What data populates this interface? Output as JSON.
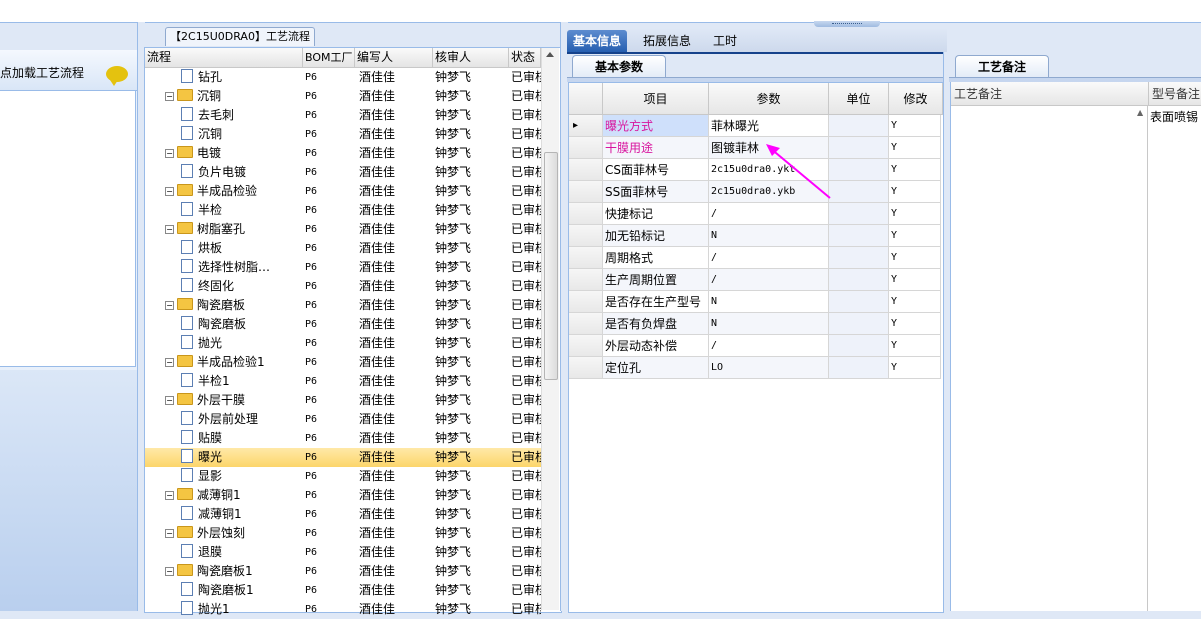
{
  "flow_panel": {
    "load_text": "点加载工艺流程",
    "title": "【2C15U0DRA0】工艺流程",
    "columns": [
      "流程",
      "BOM工厂",
      "编写人",
      "核审人",
      "状态"
    ],
    "rows": [
      {
        "name": "钻孔",
        "level": 2,
        "type": "file",
        "bom": "P6",
        "writer": "酒佳佳",
        "reviewer": "钟梦飞",
        "status": "已审核"
      },
      {
        "name": "沉铜",
        "level": 1,
        "type": "folder",
        "bom": "P6",
        "writer": "酒佳佳",
        "reviewer": "钟梦飞",
        "status": "已审核"
      },
      {
        "name": "去毛刺",
        "level": 2,
        "type": "file",
        "bom": "P6",
        "writer": "酒佳佳",
        "reviewer": "钟梦飞",
        "status": "已审核"
      },
      {
        "name": "沉铜",
        "level": 2,
        "type": "file",
        "bom": "P6",
        "writer": "酒佳佳",
        "reviewer": "钟梦飞",
        "status": "已审核"
      },
      {
        "name": "电镀",
        "level": 1,
        "type": "folder",
        "bom": "P6",
        "writer": "酒佳佳",
        "reviewer": "钟梦飞",
        "status": "已审核"
      },
      {
        "name": "负片电镀",
        "level": 2,
        "type": "file",
        "bom": "P6",
        "writer": "酒佳佳",
        "reviewer": "钟梦飞",
        "status": "已审核"
      },
      {
        "name": "半成品检验",
        "level": 1,
        "type": "folder",
        "bom": "P6",
        "writer": "酒佳佳",
        "reviewer": "钟梦飞",
        "status": "已审核"
      },
      {
        "name": "半检",
        "level": 2,
        "type": "file",
        "bom": "P6",
        "writer": "酒佳佳",
        "reviewer": "钟梦飞",
        "status": "已审核"
      },
      {
        "name": "树脂塞孔",
        "level": 1,
        "type": "folder",
        "bom": "P6",
        "writer": "酒佳佳",
        "reviewer": "钟梦飞",
        "status": "已审核"
      },
      {
        "name": "烘板",
        "level": 2,
        "type": "file",
        "bom": "P6",
        "writer": "酒佳佳",
        "reviewer": "钟梦飞",
        "status": "已审核"
      },
      {
        "name": "选择性树脂…",
        "level": 2,
        "type": "file",
        "bom": "P6",
        "writer": "酒佳佳",
        "reviewer": "钟梦飞",
        "status": "已审核"
      },
      {
        "name": "终固化",
        "level": 2,
        "type": "file",
        "bom": "P6",
        "writer": "酒佳佳",
        "reviewer": "钟梦飞",
        "status": "已审核"
      },
      {
        "name": "陶瓷磨板",
        "level": 1,
        "type": "folder",
        "bom": "P6",
        "writer": "酒佳佳",
        "reviewer": "钟梦飞",
        "status": "已审核"
      },
      {
        "name": "陶瓷磨板",
        "level": 2,
        "type": "file",
        "bom": "P6",
        "writer": "酒佳佳",
        "reviewer": "钟梦飞",
        "status": "已审核"
      },
      {
        "name": "抛光",
        "level": 2,
        "type": "file",
        "bom": "P6",
        "writer": "酒佳佳",
        "reviewer": "钟梦飞",
        "status": "已审核"
      },
      {
        "name": "半成品检验1",
        "level": 1,
        "type": "folder",
        "bom": "P6",
        "writer": "酒佳佳",
        "reviewer": "钟梦飞",
        "status": "已审核"
      },
      {
        "name": "半检1",
        "level": 2,
        "type": "file",
        "bom": "P6",
        "writer": "酒佳佳",
        "reviewer": "钟梦飞",
        "status": "已审核"
      },
      {
        "name": "外层干膜",
        "level": 1,
        "type": "folder",
        "bom": "P6",
        "writer": "酒佳佳",
        "reviewer": "钟梦飞",
        "status": "已审核"
      },
      {
        "name": "外层前处理",
        "level": 2,
        "type": "file",
        "bom": "P6",
        "writer": "酒佳佳",
        "reviewer": "钟梦飞",
        "status": "已审核"
      },
      {
        "name": "贴膜",
        "level": 2,
        "type": "file",
        "bom": "P6",
        "writer": "酒佳佳",
        "reviewer": "钟梦飞",
        "status": "已审核"
      },
      {
        "name": "曝光",
        "level": 2,
        "type": "file",
        "bom": "P6",
        "writer": "酒佳佳",
        "reviewer": "钟梦飞",
        "status": "已审核",
        "selected": true
      },
      {
        "name": "显影",
        "level": 2,
        "type": "file",
        "bom": "P6",
        "writer": "酒佳佳",
        "reviewer": "钟梦飞",
        "status": "已审核"
      },
      {
        "name": "减薄铜1",
        "level": 1,
        "type": "folder",
        "bom": "P6",
        "writer": "酒佳佳",
        "reviewer": "钟梦飞",
        "status": "已审核"
      },
      {
        "name": "减薄铜1",
        "level": 2,
        "type": "file",
        "bom": "P6",
        "writer": "酒佳佳",
        "reviewer": "钟梦飞",
        "status": "已审核"
      },
      {
        "name": "外层蚀刻",
        "level": 1,
        "type": "folder",
        "bom": "P6",
        "writer": "酒佳佳",
        "reviewer": "钟梦飞",
        "status": "已审核"
      },
      {
        "name": "退膜",
        "level": 2,
        "type": "file",
        "bom": "P6",
        "writer": "酒佳佳",
        "reviewer": "钟梦飞",
        "status": "已审核"
      },
      {
        "name": "陶瓷磨板1",
        "level": 1,
        "type": "folder",
        "bom": "P6",
        "writer": "酒佳佳",
        "reviewer": "钟梦飞",
        "status": "已审核"
      },
      {
        "name": "陶瓷磨板1",
        "level": 2,
        "type": "file",
        "bom": "P6",
        "writer": "酒佳佳",
        "reviewer": "钟梦飞",
        "status": "已审核"
      },
      {
        "name": "抛光1",
        "level": 2,
        "type": "file",
        "bom": "P6",
        "writer": "酒佳佳",
        "reviewer": "钟梦飞",
        "status": "已审核"
      }
    ]
  },
  "info_tabs": [
    "基本信息",
    "拓展信息",
    "工时"
  ],
  "basic": {
    "subtab": "基本参数",
    "columns": [
      "项目",
      "参数",
      "单位",
      "修改"
    ],
    "rows": [
      {
        "item": "曝光方式",
        "param": "菲林曝光",
        "unit": "",
        "modify": "Y",
        "magenta": true,
        "current": true
      },
      {
        "item": "干膜用途",
        "param": "图镀菲林",
        "unit": "",
        "modify": "Y",
        "magenta": true
      },
      {
        "item": "CS面菲林号",
        "param": "2c15u0dra0.ykt",
        "unit": "",
        "modify": "Y"
      },
      {
        "item": "SS面菲林号",
        "param": "2c15u0dra0.ykb",
        "unit": "",
        "modify": "Y"
      },
      {
        "item": "快捷标记",
        "param": "/",
        "unit": "",
        "modify": "Y"
      },
      {
        "item": "加无铅标记",
        "param": "N",
        "unit": "",
        "modify": "Y"
      },
      {
        "item": "周期格式",
        "param": "/",
        "unit": "",
        "modify": "Y"
      },
      {
        "item": "生产周期位置",
        "param": "/",
        "unit": "",
        "modify": "Y"
      },
      {
        "item": "是否存在生产型号",
        "param": "N",
        "unit": "",
        "modify": "Y"
      },
      {
        "item": "是否有负焊盘",
        "param": "N",
        "unit": "",
        "modify": "Y"
      },
      {
        "item": "外层动态补偿",
        "param": "/",
        "unit": "",
        "modify": "Y"
      },
      {
        "item": "定位孔",
        "param": "LO",
        "unit": "",
        "modify": "Y"
      }
    ]
  },
  "remarks": {
    "tab": "工艺备注",
    "col1": "工艺备注",
    "col2": "型号备注",
    "type_value": "表面喷锡"
  },
  "colors": {
    "accent": "#265fb0",
    "highlight": "#d8149e",
    "selected_row": "#fcd56a"
  }
}
